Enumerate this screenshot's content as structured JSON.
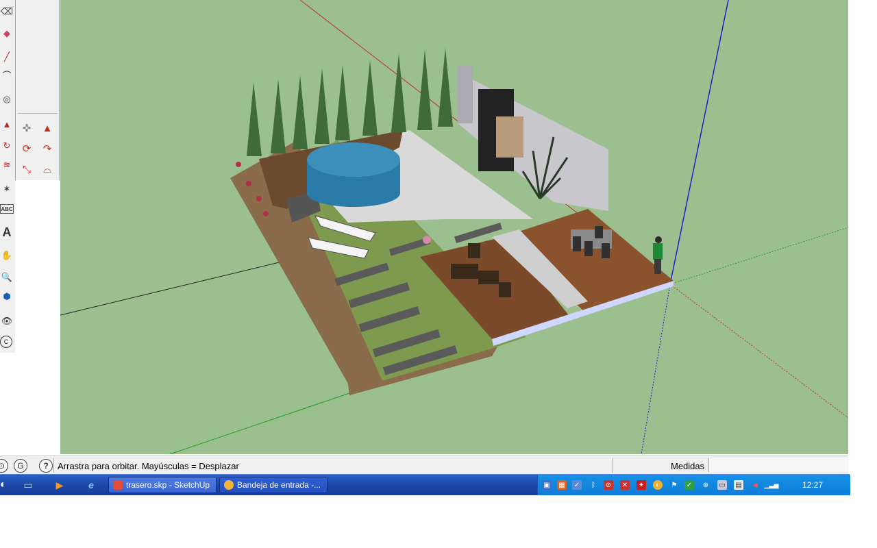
{
  "left_toolbar": {
    "tools": [
      "eraser-icon",
      "rect-icon",
      "pencil-icon",
      "arc-icon",
      "circle-icon",
      "pushpull-icon",
      "rotate-icon",
      "followme-icon",
      "tape-icon",
      "text-icon",
      "3dtext-icon",
      "pan-icon",
      "zoom-icon",
      "zoom-window-icon",
      "lookaround-icon",
      "section-icon"
    ],
    "text_tool_label": "ABC",
    "three_d_text_label": "A",
    "section_label": "C"
  },
  "sandbox_toolbar": {
    "tools": [
      "move-icon",
      "pushpull-red-icon",
      "rotate-icon",
      "followme-icon",
      "scale-icon",
      "offset-icon"
    ]
  },
  "viewport": {
    "background": "#9bbf8f",
    "axis_colors": {
      "red": "#c03030",
      "green": "#20a020",
      "blue": "#2020c8"
    }
  },
  "status_bar": {
    "hint_text": "Arrastra para orbitar. Mayúsculas = Desplazar",
    "measure_label": "Medidas",
    "measure_value": ""
  },
  "taskbar": {
    "tasks": [
      {
        "label": "trasero.skp - SketchUp"
      },
      {
        "label": "Bandeja de entrada -..."
      }
    ],
    "clock": "12:27"
  }
}
